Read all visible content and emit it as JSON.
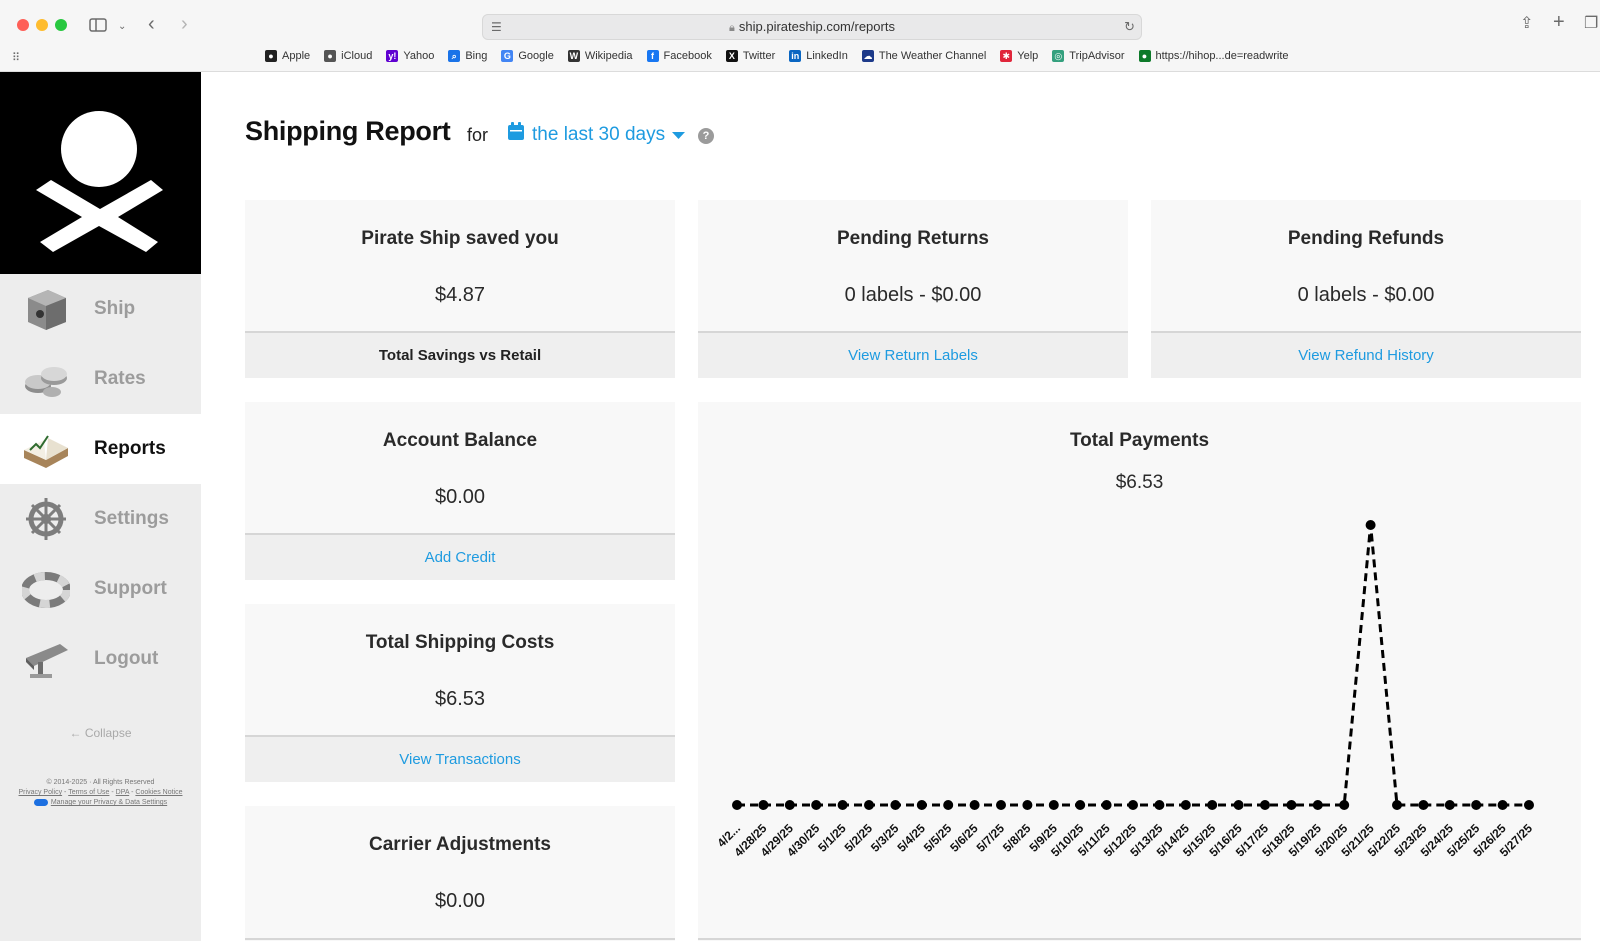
{
  "browser": {
    "url": "ship.pirateship.com/reports",
    "bookmarks": [
      {
        "label": "Apple",
        "icon": "apple-icon",
        "color": "#222222"
      },
      {
        "label": "iCloud",
        "icon": "apple-icon",
        "color": "#555555"
      },
      {
        "label": "Yahoo",
        "icon": "yahoo-icon",
        "color": "#5f01d1"
      },
      {
        "label": "Bing",
        "icon": "search-icon",
        "color": "#1a73e8"
      },
      {
        "label": "Google",
        "icon": "google-icon",
        "color": "#4285f4"
      },
      {
        "label": "Wikipedia",
        "icon": "wikipedia-icon",
        "color": "#333333"
      },
      {
        "label": "Facebook",
        "icon": "facebook-icon",
        "color": "#1877f2"
      },
      {
        "label": "Twitter",
        "icon": "x-icon",
        "color": "#111111"
      },
      {
        "label": "LinkedIn",
        "icon": "linkedin-icon",
        "color": "#0a66c2"
      },
      {
        "label": "The Weather Channel",
        "icon": "weather-icon",
        "color": "#1d3a8a"
      },
      {
        "label": "Yelp",
        "icon": "yelp-icon",
        "color": "#e0263b"
      },
      {
        "label": "TripAdvisor",
        "icon": "tripadvisor-icon",
        "color": "#34a07e"
      },
      {
        "label": "https://hihop...de=readwrite",
        "icon": "globe-icon",
        "color": "#0d7a2a"
      }
    ]
  },
  "sidebar": {
    "items": [
      {
        "label": "Ship",
        "icon": "box-icon"
      },
      {
        "label": "Rates",
        "icon": "coins-icon"
      },
      {
        "label": "Reports",
        "icon": "book-icon",
        "active": true
      },
      {
        "label": "Settings",
        "icon": "ship-wheel-icon"
      },
      {
        "label": "Support",
        "icon": "life-ring-icon"
      },
      {
        "label": "Logout",
        "icon": "plank-icon"
      }
    ],
    "collapse_label": "Collapse",
    "legal": {
      "copyright": "© 2014-2025 · All Rights Reserved",
      "privacy": "Privacy Policy",
      "terms": "Terms of Use",
      "dpa": "DPA",
      "cookies": "Cookies Notice",
      "manage": "Manage your Privacy & Data Settings"
    }
  },
  "header": {
    "title": "Shipping Report",
    "for_text": "for",
    "date_range": "the last 30 days"
  },
  "cards": {
    "savings": {
      "title": "Pirate Ship saved you",
      "value": "$4.87",
      "footer": "Total Savings vs Retail"
    },
    "returns": {
      "title": "Pending Returns",
      "value": "0 labels - $0.00",
      "footer": "View Return Labels"
    },
    "refunds": {
      "title": "Pending Refunds",
      "value": "0 labels - $0.00",
      "footer": "View Refund History"
    },
    "balance": {
      "title": "Account Balance",
      "value": "$0.00",
      "footer": "Add Credit"
    },
    "shipping": {
      "title": "Total Shipping Costs",
      "value": "$6.53",
      "footer": "View Transactions"
    },
    "adjustments": {
      "title": "Carrier Adjustments",
      "value": "$0.00"
    },
    "payments": {
      "title": "Total Payments",
      "value": "$6.53"
    }
  },
  "chart_data": {
    "type": "line",
    "title": "Total Payments",
    "categories": [
      "4/2...",
      "4/28/25",
      "4/29/25",
      "4/30/25",
      "5/1/25",
      "5/2/25",
      "5/3/25",
      "5/4/25",
      "5/5/25",
      "5/6/25",
      "5/7/25",
      "5/8/25",
      "5/9/25",
      "5/10/25",
      "5/11/25",
      "5/12/25",
      "5/13/25",
      "5/14/25",
      "5/15/25",
      "5/16/25",
      "5/17/25",
      "5/18/25",
      "5/19/25",
      "5/20/25",
      "5/21/25",
      "5/22/25",
      "5/23/25",
      "5/24/25",
      "5/25/25",
      "5/26/25",
      "5/27/25"
    ],
    "series": [
      {
        "values": [
          0,
          0,
          0,
          0,
          0,
          0,
          0,
          0,
          0,
          0,
          0,
          0,
          0,
          0,
          0,
          0,
          0,
          0,
          0,
          0,
          0,
          0,
          0,
          0,
          6.53,
          0,
          0,
          0,
          0,
          0,
          0,
          0
        ]
      }
    ],
    "style": "dashed line with dot markers",
    "color": "#000000"
  }
}
